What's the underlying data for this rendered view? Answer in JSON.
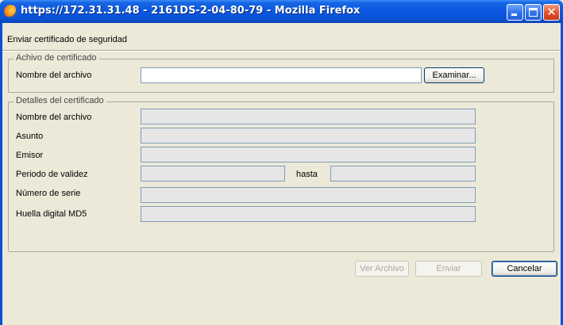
{
  "window": {
    "title": "https://172.31.31.48 - 2161DS-2-04-80-79 - Mozilla Firefox"
  },
  "dialog": {
    "header": "Enviar certificado de seguridad",
    "file_group": {
      "legend": "Achivo de certificado",
      "filename_label": "Nombre del archivo",
      "filename_value": "",
      "browse_label": "Examinar..."
    },
    "details_group": {
      "legend": "Detalles del certificado",
      "filename_label": "Nombre del archivo",
      "subject_label": "Asunto",
      "issuer_label": "Emisor",
      "validity_label": "Periodo de validez",
      "until_label": "hasta",
      "serial_label": "Número de serie",
      "md5_label": "Huella digital MD5"
    },
    "buttons": {
      "view": "Ver Archivo",
      "send": "Enviar",
      "cancel": "Cancelar"
    }
  },
  "colors": {
    "titlebar": "#0a52d6",
    "dialog_bg": "#ece9d8",
    "field_border": "#7f9db9",
    "disabled_text": "#aca899"
  },
  "icons": {
    "app": "firefox-icon",
    "minimize": "minimize-icon",
    "maximize": "maximize-icon",
    "close": "close-icon"
  }
}
